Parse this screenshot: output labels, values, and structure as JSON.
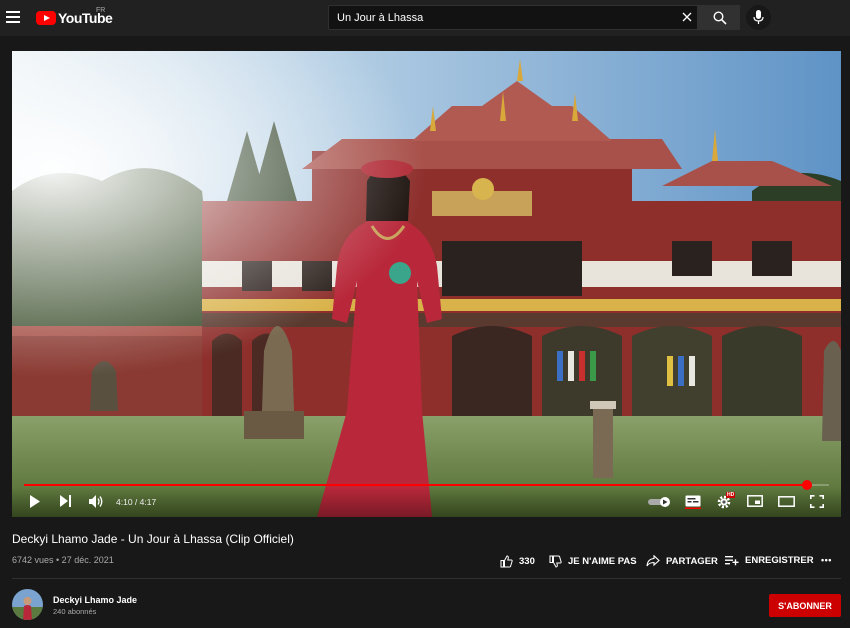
{
  "header": {
    "logo_text": "YouTube",
    "country_code": "FR",
    "search_value": "Un Jour à Lhassa",
    "icons": [
      "menu-icon",
      "youtube-logo-icon",
      "clear-icon",
      "search-icon",
      "microphone-icon"
    ]
  },
  "player": {
    "time": "4:10 / 4:17",
    "progress": 0.973,
    "accent_color": "#ff0000",
    "icons": [
      "play-icon",
      "next-icon",
      "volume-icon",
      "autoplay-toggle-icon",
      "subtitles-icon",
      "settings-icon",
      "miniplayer-icon",
      "theater-icon",
      "fullscreen-icon"
    ],
    "settings_badge": "HD"
  },
  "video": {
    "title": "Deckyi Lhamo Jade - Un Jour à Lhassa (Clip Officiel)",
    "views_date": "6742 vues • 27 déc. 2021",
    "like_count": "330",
    "dislike_label": "JE N'AIME PAS",
    "share_label": "PARTAGER",
    "save_label": "ENREGISTRER",
    "more_label": "•••"
  },
  "channel": {
    "name": "Deckyi Lhamo Jade",
    "subscribers": "240 abonnés",
    "subscribe_label": "S'ABONNER",
    "subscribe_color": "#cc0000"
  }
}
